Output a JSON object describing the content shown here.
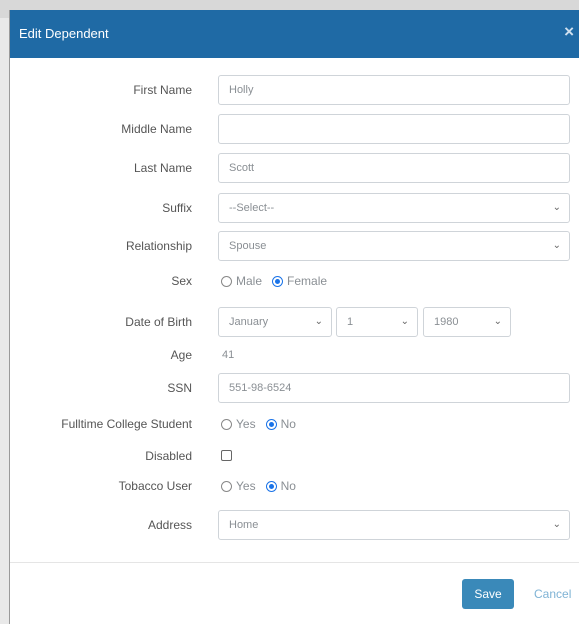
{
  "dialog": {
    "title": "Edit Dependent",
    "close_label": "×"
  },
  "fields": {
    "first_name": {
      "label": "First Name",
      "value": "Holly"
    },
    "middle_name": {
      "label": "Middle Name",
      "value": ""
    },
    "last_name": {
      "label": "Last Name",
      "value": "Scott"
    },
    "suffix": {
      "label": "Suffix",
      "value": "--Select--"
    },
    "relationship": {
      "label": "Relationship",
      "value": "Spouse"
    },
    "sex": {
      "label": "Sex",
      "options": [
        "Male",
        "Female"
      ],
      "selected": "Female"
    },
    "dob": {
      "label": "Date of Birth",
      "month": "January",
      "day": "1",
      "year": "1980"
    },
    "age": {
      "label": "Age",
      "value": "41"
    },
    "ssn": {
      "label": "SSN",
      "value": "551-98-6524"
    },
    "college": {
      "label": "Fulltime College Student",
      "options": [
        "Yes",
        "No"
      ],
      "selected": "No"
    },
    "disabled": {
      "label": "Disabled",
      "checked": false
    },
    "tobacco": {
      "label": "Tobacco User",
      "options": [
        "Yes",
        "No"
      ],
      "selected": "No"
    },
    "address": {
      "label": "Address",
      "value": "Home"
    }
  },
  "footer": {
    "save_label": "Save",
    "cancel_label": "Cancel"
  },
  "icons": {
    "dropdown": "chevron-down-icon",
    "close": "close-icon"
  },
  "colors": {
    "header": "#1f6aa5",
    "save_button": "#3a89b9",
    "radio_selected": "#1a73e8"
  }
}
